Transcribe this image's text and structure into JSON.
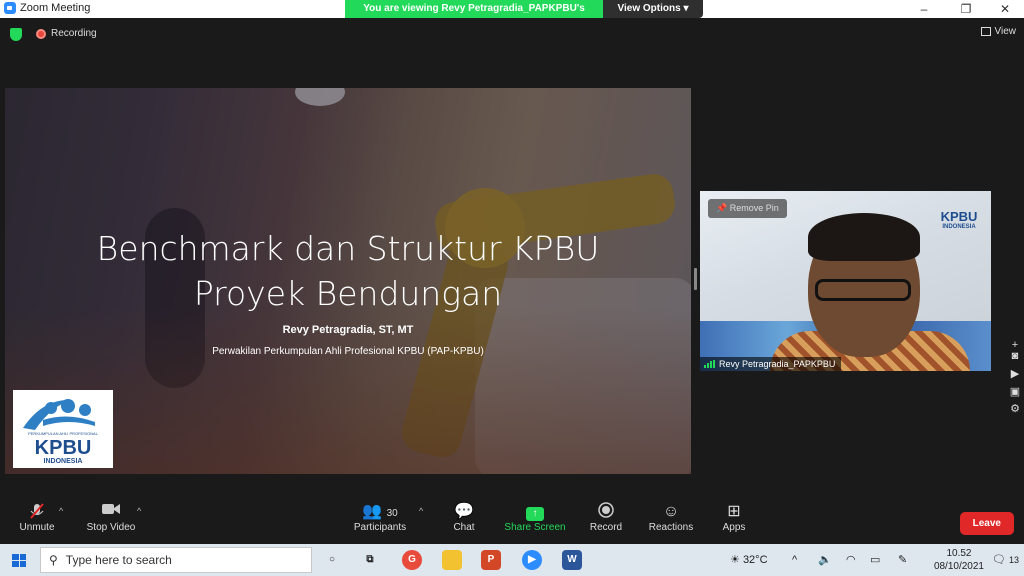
{
  "window": {
    "title": "Zoom Meeting",
    "minimize": "–",
    "restore": "❐",
    "close": "✕"
  },
  "banner": {
    "viewing": "You are viewing Revy Petragradia_PAPKPBU's screen",
    "view_options": "View Options ▾"
  },
  "topbar": {
    "recording": "Recording",
    "view": "View"
  },
  "slide": {
    "title_line1": "Benchmark dan Struktur KPBU",
    "title_line2": "Proyek Bendungan",
    "speaker": "Revy Petragradia, ST, MT",
    "organization": "Perwakilan Perkumpulan Ahli Profesional KPBU (PAP-KPBU)",
    "logo_text": "KPBU",
    "logo_sub": "INDONESIA",
    "logo_tiny": "PERKUMPULAN AHLI PROFESIONAL"
  },
  "video": {
    "remove_pin": "Remove Pin",
    "participant_name": "Revy Petragradia_PAPKPBU",
    "logo_text": "KPBU",
    "logo_sub": "INDONESIA"
  },
  "toolbar": {
    "unmute": "Unmute",
    "stop_video": "Stop Video",
    "participants": "Participants",
    "participants_count": "30",
    "chat": "Chat",
    "share_screen": "Share Screen",
    "record": "Record",
    "reactions": "Reactions",
    "apps": "Apps",
    "leave": "Leave"
  },
  "taskbar": {
    "search_placeholder": "Type here to search",
    "temperature": "32°C",
    "time": "10.52",
    "date": "08/10/2021",
    "notifications": "13"
  },
  "colors": {
    "accent_green": "#23d959",
    "leave_red": "#e02828",
    "zoom_blue": "#2d8cff"
  }
}
